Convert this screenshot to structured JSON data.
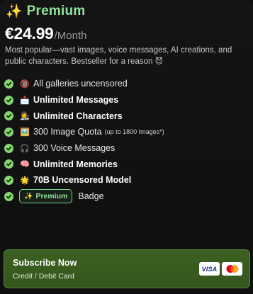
{
  "plan": {
    "sparkle_icon": "✨",
    "title": "Premium",
    "price": "€24.99",
    "period": "/Month",
    "description": "Most popular—vast images, voice messages, AI creations, and public characters. Bestseller for a reason",
    "description_emoji": "😈"
  },
  "features": [
    {
      "emoji": "🔞",
      "label": "All galleries uncensored",
      "bold": false,
      "note": ""
    },
    {
      "emoji": "📩",
      "label": "Unlimited Messages",
      "bold": true,
      "note": ""
    },
    {
      "emoji": "🧑‍🎨",
      "label": "Unlimited Characters",
      "bold": true,
      "note": ""
    },
    {
      "emoji": "🖼️",
      "label": "300 Image Quota",
      "bold": false,
      "note": "(up to 1800 Images*)"
    },
    {
      "emoji": "🎧",
      "label": "300 Voice Messages",
      "bold": false,
      "note": ""
    },
    {
      "emoji": "🧠",
      "label": "Unlimited Memories",
      "bold": true,
      "note": ""
    },
    {
      "emoji": "🌟",
      "label": "70B Uncensored Model",
      "bold": true,
      "note": ""
    }
  ],
  "badge_feature": {
    "pill_icon": "✨",
    "pill_label": "Premium",
    "label": "Badge"
  },
  "subscribe": {
    "title": "Subscribe Now",
    "method": "Credit / Debit Card",
    "visa_label": "VISA",
    "card_icons": [
      "visa-icon",
      "mastercard-icon"
    ]
  },
  "colors": {
    "accent_green": "#8ee59b",
    "check_green": "#86d66e",
    "button_bg": "#3c6021"
  }
}
